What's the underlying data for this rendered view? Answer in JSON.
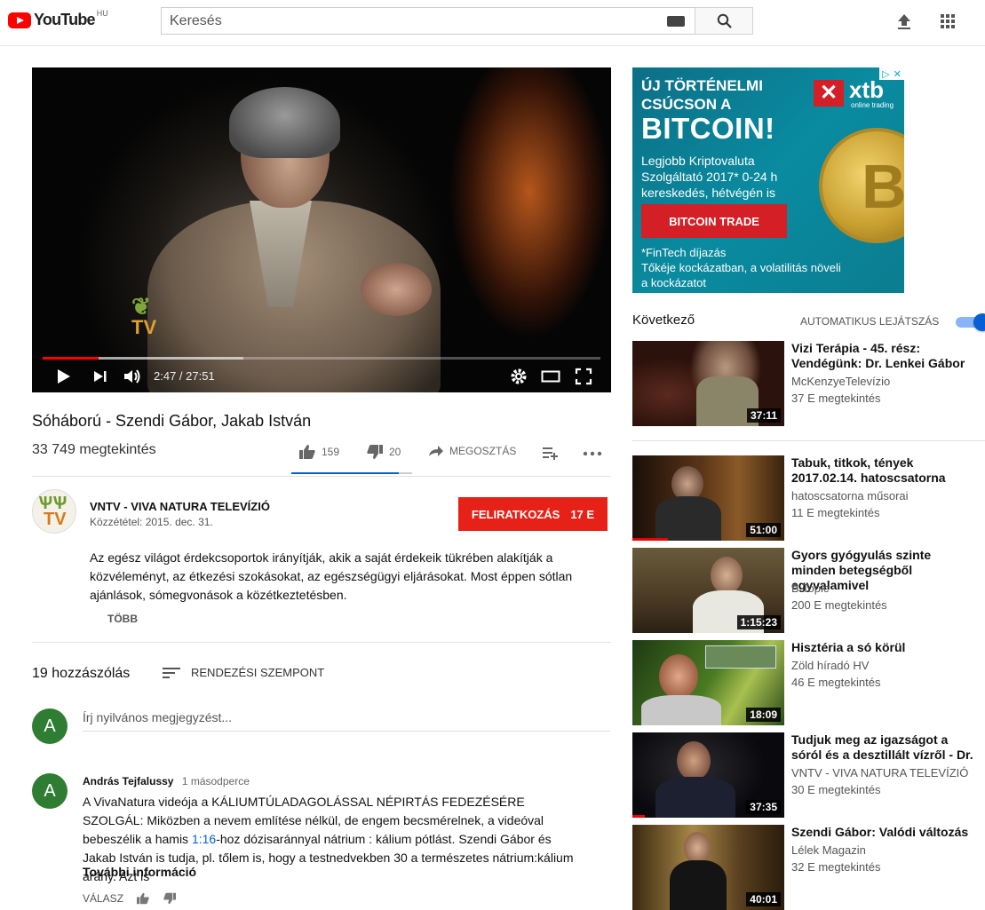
{
  "header": {
    "logo_text": "YouTube",
    "region": "HU",
    "search_placeholder": "Keresés"
  },
  "player": {
    "time": "2:47 / 27:51",
    "progress_fraction": 0.1,
    "buffered_fraction": 0.36,
    "watermark": "TV"
  },
  "video": {
    "title": "Sóháború - Szendi Gábor, Jakab István",
    "views": "33 749 megtekintés",
    "likes": "159",
    "dislikes": "20",
    "share_label": "MEGOSZTÁS",
    "like_fraction": 0.89
  },
  "owner": {
    "channel_name": "VNTV - VIVA NATURA TELEVÍZIÓ",
    "published": "Közzététel: 2015. dec. 31.",
    "subscribe_label": "FELIRATKOZÁS",
    "subscriber_count": "17 E",
    "description": "Az egész világot érdekcsoportok irányítják, akik a saját érdekeik tükrében alakítják a közvéleményt, az étkezési szokásokat, az egészségügyi eljárásokat. Most éppen sótlan ajánlások, sómegvonások a közétkeztetésben.",
    "more_label": "TÖBB",
    "avatar_text": "TV"
  },
  "comments": {
    "count_label": "19 hozzászólás",
    "sort_label": "RENDEZÉSI SZEMPONT",
    "input_placeholder": "Írj nyilvános megjegyzést...",
    "user_initial": "A",
    "items": [
      {
        "initial": "A",
        "author": "András Tejfalussy",
        "time": "1 másodperce",
        "text_before": "A VivaNatura videója a KÁLIUMTÚLADAGOLÁSSAL NÉPIRTÁS FEDEZÉSÉRE SZOLGÁL: Miközben a nevem említése nélkül, de engem becsmérelnek, a videóval bebeszélik a hamis ",
        "timestamp_link": "1:16",
        "text_after": "-hoz dózisaránnyal nátrium : kálium pótlást. Szendi Gábor és Jakab István is tudja, pl. tőlem is, hogy a testnedvekben 30 a természetes nátrium:kálium arány. Azt is",
        "read_more": "További információ",
        "reply_label": "VÁLASZ"
      }
    ]
  },
  "ad": {
    "line1": "ÚJ TÖRTÉNELMI",
    "line2": "CSÚCSON A",
    "big": "BITCOIN!",
    "desc1": "Legjobb Kriptovaluta",
    "desc2": "Szolgáltató 2017* 0-24 h",
    "desc3": "kereskedés, hétvégén is",
    "button": "BITCOIN TRADE",
    "foot1": "*FinTech díjazás",
    "foot2": "Tőkéje kockázatban, a volatilitás növeli",
    "foot3": "a kockázatot",
    "brand": "xtb",
    "brand_sub": "online trading",
    "coin_symbol": "B"
  },
  "sidebar": {
    "next_label": "Következő",
    "autoplay_label": "AUTOMATIKUS LEJÁTSZÁS",
    "autoplay_on": true,
    "videos": [
      {
        "title": "Vizi Terápia - 45. rész: Vendégünk: Dr. Lenkei Gábor",
        "channel": "McKenzyeTelevízio",
        "views": "37 E megtekintés",
        "duration": "37:11"
      },
      {
        "title": "Tabuk, titkok, tények 2017.02.14. hatoscsatorna",
        "channel": "hatoscsatorna műsorai",
        "views": "11 E megtekintés",
        "duration": "51:00"
      },
      {
        "title": "Gyors gyógyulás szinte minden betegségből egyvalamivel",
        "channel": "B Topic",
        "views": "200 E megtekintés",
        "duration": "1:15:23"
      },
      {
        "title": "Hisztéria a só körül",
        "channel": "Zöld híradó HV",
        "views": "46 E megtekintés",
        "duration": "18:09"
      },
      {
        "title": "Tudjuk meg az igazságot a sóról és a desztillált vízről - Dr.",
        "channel": "VNTV - VIVA NATURA TELEVÍZIÓ",
        "views": "30 E megtekintés",
        "duration": "37:35"
      },
      {
        "title": "Szendi Gábor: Valódi változás",
        "channel": "Lélek Magazin",
        "views": "32 E megtekintés",
        "duration": "40:01"
      }
    ]
  }
}
